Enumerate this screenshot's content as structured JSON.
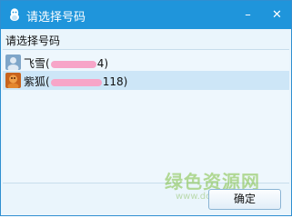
{
  "window": {
    "title": "请选择号码",
    "minimize_glyph": "–",
    "close_glyph": "✕"
  },
  "prompt": "请选择号码",
  "accounts": [
    {
      "name_prefix": "飞雪(",
      "visible_suffix": "4)",
      "avatar": "avatar-icon-blue"
    },
    {
      "name_prefix": "紫狐(",
      "visible_suffix": "118)",
      "avatar": "avatar-icon-orange"
    }
  ],
  "buttons": {
    "ok_label": "确定"
  },
  "watermark": {
    "text": "绿色资源网",
    "url": "www.downcc.com"
  },
  "colors": {
    "titlebar": "#1f95db",
    "selected_row": "#cde6f7",
    "redaction": "#f7a5c8"
  }
}
